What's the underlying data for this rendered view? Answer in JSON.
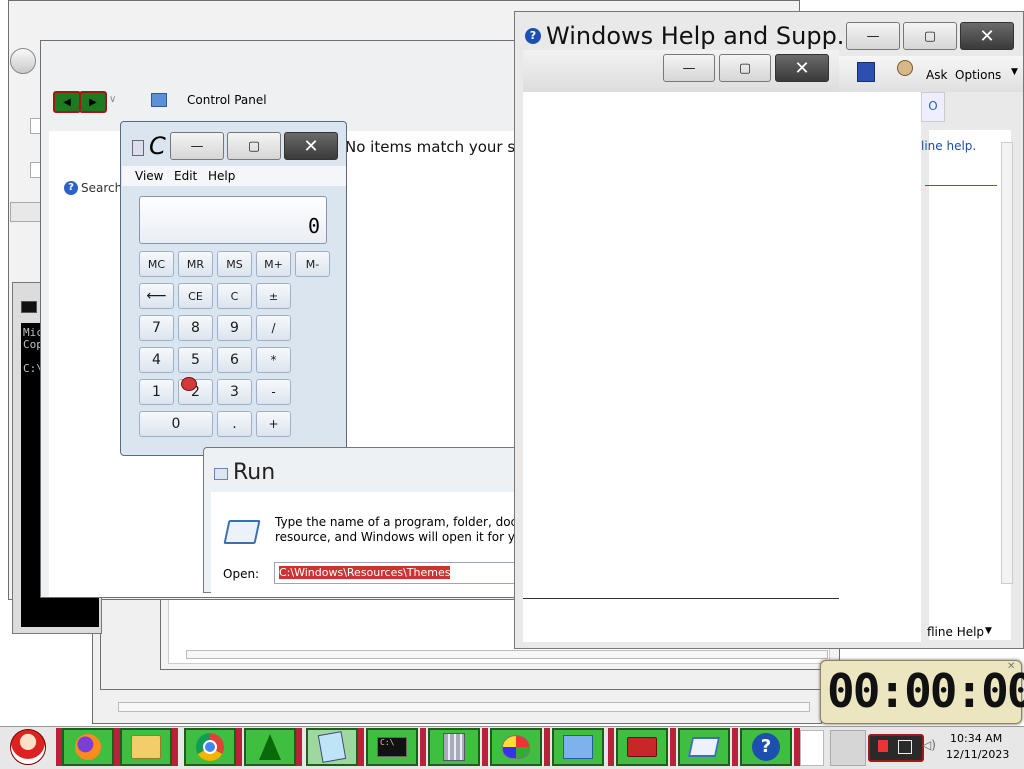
{
  "colors": {
    "taskbar_green": "#3fbf3f",
    "taskbar_divider": "#b8223a",
    "timer_bg": "#ece6c0",
    "selection_bg": "#cc3333",
    "help_icon": "#1c4fb0"
  },
  "control_panel": {
    "address": "Control Panel",
    "search_text": "Search",
    "no_items_text": "No items match your sea"
  },
  "calculator": {
    "title": "C",
    "menu": [
      "View",
      "Edit",
      "Help"
    ],
    "display": "0",
    "buttons": {
      "mc": "MC",
      "mr": "MR",
      "ms": "MS",
      "mplus": "M+",
      "mminus": "M-",
      "back": "⟵",
      "ce": "CE",
      "c": "C",
      "plusminus": "±",
      "n7": "7",
      "n8": "8",
      "n9": "9",
      "divide": "/",
      "n4": "4",
      "n5": "5",
      "n6": "6",
      "multiply": "*",
      "n1": "1",
      "n2": "2",
      "n3": "3",
      "minus": "-",
      "n0": "0",
      "dot": ".",
      "plus": "+"
    }
  },
  "help_window": {
    "title": "Windows Help and Supp...",
    "ask": "Ask",
    "options": "Options",
    "online_help": "line help.",
    "offline_help": "fline Help"
  },
  "cmd_window": {
    "lines": [
      "Mic",
      "Cop",
      "",
      "C:\\"
    ]
  },
  "run_dialog": {
    "title": "Run",
    "description_line1": "Type the name of a program, folder, documer",
    "description_line2": "resource, and Windows will open it for you.",
    "open_label": "Open:",
    "open_value": "C:\\Windows\\Resources\\Themes"
  },
  "timer": {
    "value": "00:00:00"
  },
  "taskbar": {
    "items": [
      {
        "name": "firefox",
        "icon": "firefox-icon"
      },
      {
        "name": "explorer",
        "icon": "folder-icon"
      },
      {
        "name": "chrome",
        "icon": "chrome-icon"
      },
      {
        "name": "christmas-tree",
        "icon": "tree-icon"
      },
      {
        "name": "notepad",
        "icon": "notepad-icon"
      },
      {
        "name": "cmd",
        "icon": "cmd-icon",
        "label": "C:\\"
      },
      {
        "name": "calculator",
        "icon": "calculator-icon"
      },
      {
        "name": "paint",
        "icon": "paint-icon"
      },
      {
        "name": "control-panel",
        "icon": "control-panel-icon"
      },
      {
        "name": "toolbox",
        "icon": "toolbox-icon"
      },
      {
        "name": "run",
        "icon": "run-icon"
      },
      {
        "name": "help",
        "icon": "help-icon",
        "label": "?"
      }
    ],
    "clock_time": "10:34 AM",
    "clock_date": "12/11/2023"
  }
}
